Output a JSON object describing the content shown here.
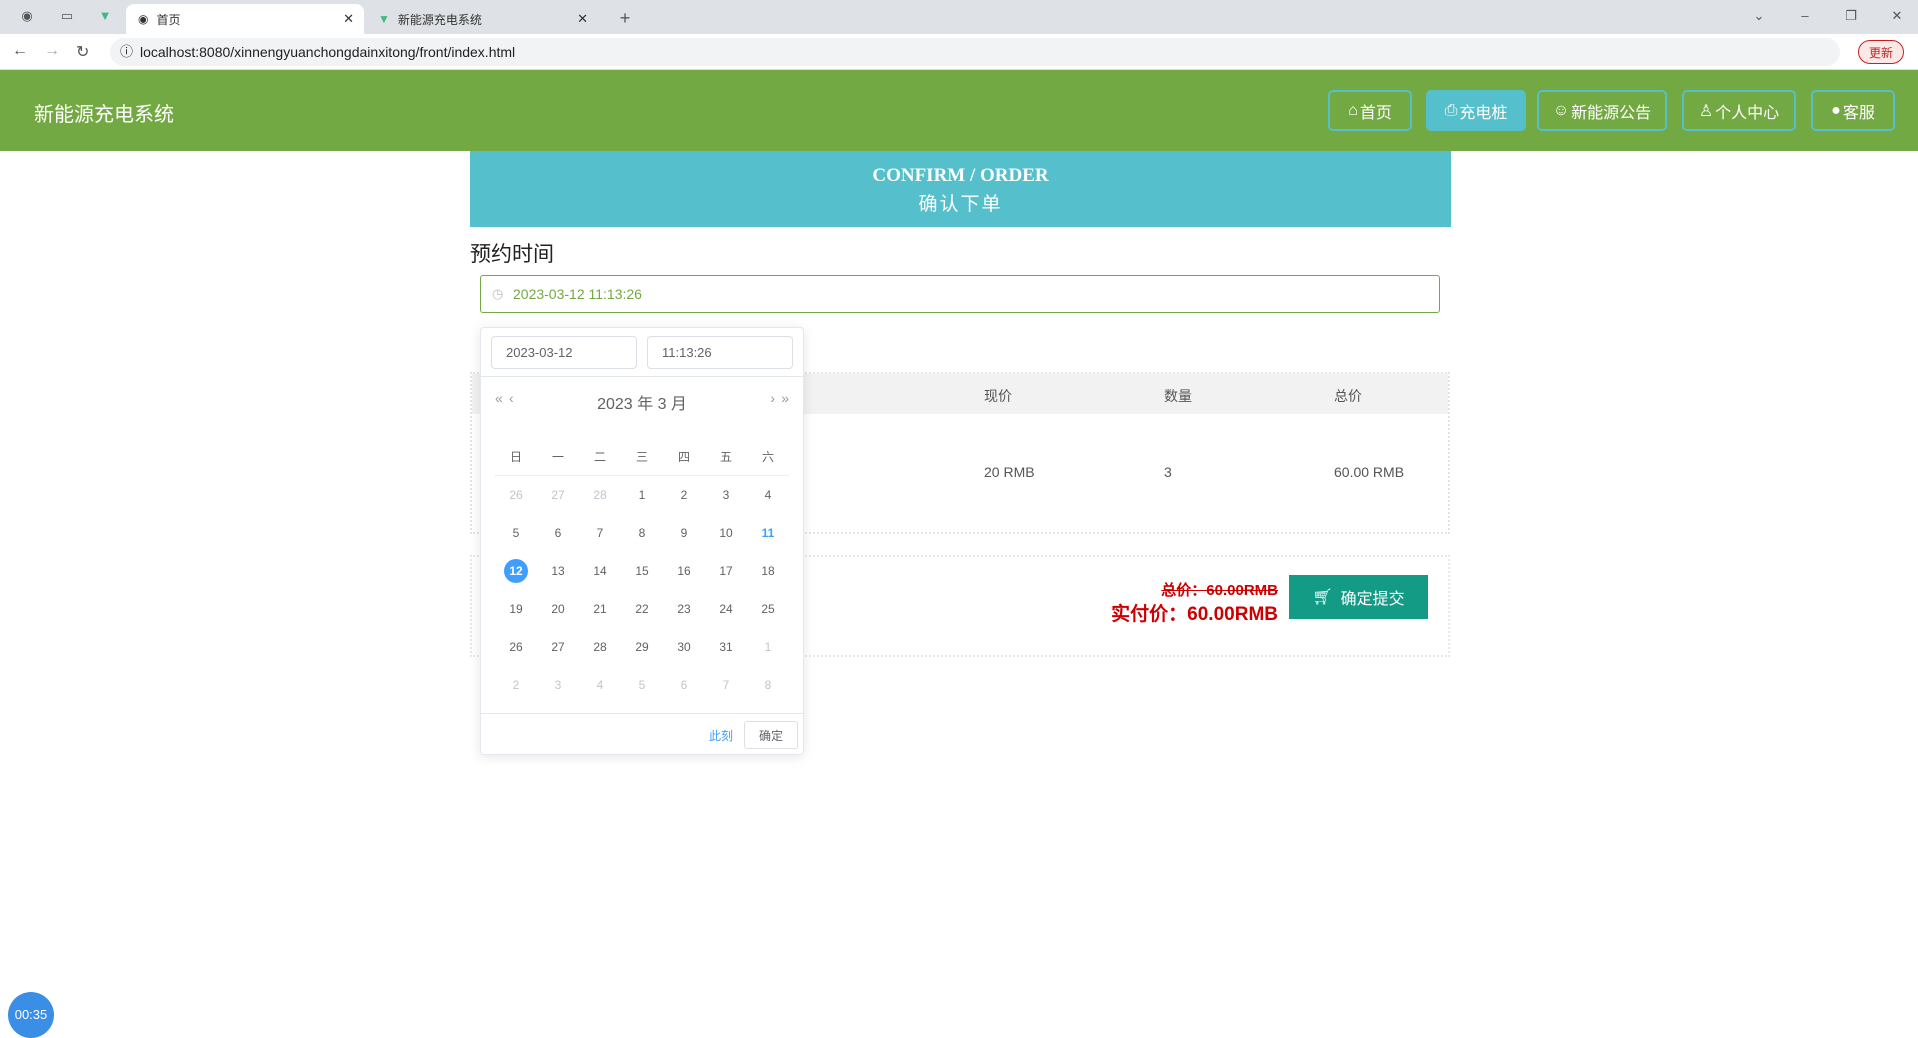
{
  "browser": {
    "tabs": [
      {
        "label": "首页",
        "icon": "globe-icon"
      },
      {
        "label": "新能源充电系统",
        "icon": "vue-icon"
      }
    ],
    "url": "localhost:8080/xinnengyuanchongdainxitong/front/index.html",
    "update_label": "更新"
  },
  "header": {
    "brand": "新能源充电系统",
    "nav": [
      {
        "label": "首页",
        "icon": "home-icon"
      },
      {
        "label": "充电桩",
        "icon": "printer-icon",
        "active": true
      },
      {
        "label": "新能源公告",
        "icon": "palette-icon"
      },
      {
        "label": "个人中心",
        "icon": "user-icon"
      },
      {
        "label": "客服",
        "icon": "wechat-icon"
      }
    ]
  },
  "banner": {
    "en": "CONFIRM / ORDER",
    "cn": "确认下单"
  },
  "form": {
    "label": "预约时间",
    "value": "2023-03-12 11:13:26"
  },
  "table": {
    "headers": [
      "现价",
      "数量",
      "总价"
    ],
    "row": [
      "20 RMB",
      "3",
      "60.00 RMB"
    ]
  },
  "summary": {
    "original": "总价：60.00RMB",
    "actual": "实付价：60.00RMB",
    "submit": "确定提交"
  },
  "picker": {
    "date": "2023-03-12",
    "time": "11:13:26",
    "title": "2023 年  3 月",
    "weekdays": [
      "日",
      "一",
      "二",
      "三",
      "四",
      "五",
      "六"
    ],
    "weeks": [
      [
        "26",
        "27",
        "28",
        "1",
        "2",
        "3",
        "4"
      ],
      [
        "5",
        "6",
        "7",
        "8",
        "9",
        "10",
        "11"
      ],
      [
        "12",
        "13",
        "14",
        "15",
        "16",
        "17",
        "18"
      ],
      [
        "19",
        "20",
        "21",
        "22",
        "23",
        "24",
        "25"
      ],
      [
        "26",
        "27",
        "28",
        "29",
        "30",
        "31",
        "1"
      ],
      [
        "2",
        "3",
        "4",
        "5",
        "6",
        "7",
        "8"
      ]
    ],
    "today": "11",
    "selected": "12",
    "now_label": "此刻",
    "ok_label": "确定"
  },
  "timer": "00:35",
  "colors": {
    "header": "#73a942",
    "accent": "#55bfcb",
    "submit": "#139b86",
    "price": "#cc0000",
    "selected": "#409eff"
  }
}
